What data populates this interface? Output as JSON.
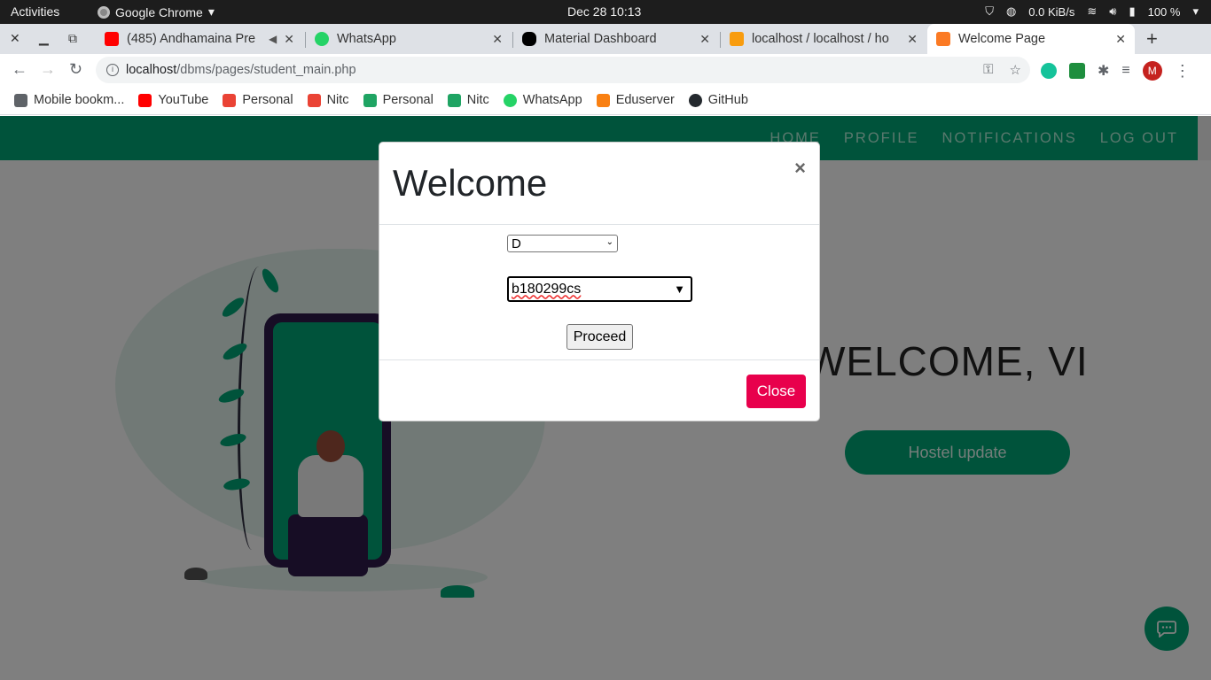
{
  "system_bar": {
    "activities": "Activities",
    "app_name": "Google Chrome",
    "clock": "Dec 28  10:13",
    "network_speed": "0.0 KiB/s",
    "battery": "100 %"
  },
  "tabs": [
    {
      "title": "(485) Andhamaina Pre",
      "favicon_color": "#ff0000"
    },
    {
      "title": "WhatsApp",
      "favicon_color": "#25d366"
    },
    {
      "title": "Material Dashboard",
      "favicon_color": "#000000"
    },
    {
      "title": "localhost / localhost / ho",
      "favicon_color": "#f89c0e"
    },
    {
      "title": "Welcome Page",
      "favicon_color": "#fb7a24",
      "active": true
    }
  ],
  "address_bar": {
    "url_host": "localhost",
    "url_path": "/dbms/pages/student_main.php"
  },
  "profile_initial": "M",
  "bookmarks": [
    {
      "label": "Mobile bookm...",
      "icon": "folder-icon",
      "color": "#5f6368"
    },
    {
      "label": "YouTube",
      "icon": "youtube-icon",
      "color": "#ff0000"
    },
    {
      "label": "Personal",
      "icon": "gmail-icon",
      "color": "#ea4335"
    },
    {
      "label": "Nitc",
      "icon": "gmail-icon",
      "color": "#ea4335"
    },
    {
      "label": "Personal",
      "icon": "drive-icon",
      "color": "#1fa463"
    },
    {
      "label": "Nitc",
      "icon": "drive-icon",
      "color": "#1fa463"
    },
    {
      "label": "WhatsApp",
      "icon": "whatsapp-icon",
      "color": "#25d366"
    },
    {
      "label": "Eduserver",
      "icon": "moodle-icon",
      "color": "#f98012"
    },
    {
      "label": "GitHub",
      "icon": "github-icon",
      "color": "#24292e"
    }
  ],
  "site": {
    "nav": [
      "HOME",
      "PROFILE",
      "NOTIFICATIONS",
      "LOG OUT"
    ],
    "welcome_text": "WELCOME, VI",
    "hostel_button": "Hostel update",
    "accent_color": "#00a676"
  },
  "modal": {
    "title": "Welcome",
    "close_x": "×",
    "select1_value": "D",
    "select2_value": "b180299cs",
    "proceed_label": "Proceed",
    "close_label": "Close",
    "close_color": "#e8004c"
  }
}
